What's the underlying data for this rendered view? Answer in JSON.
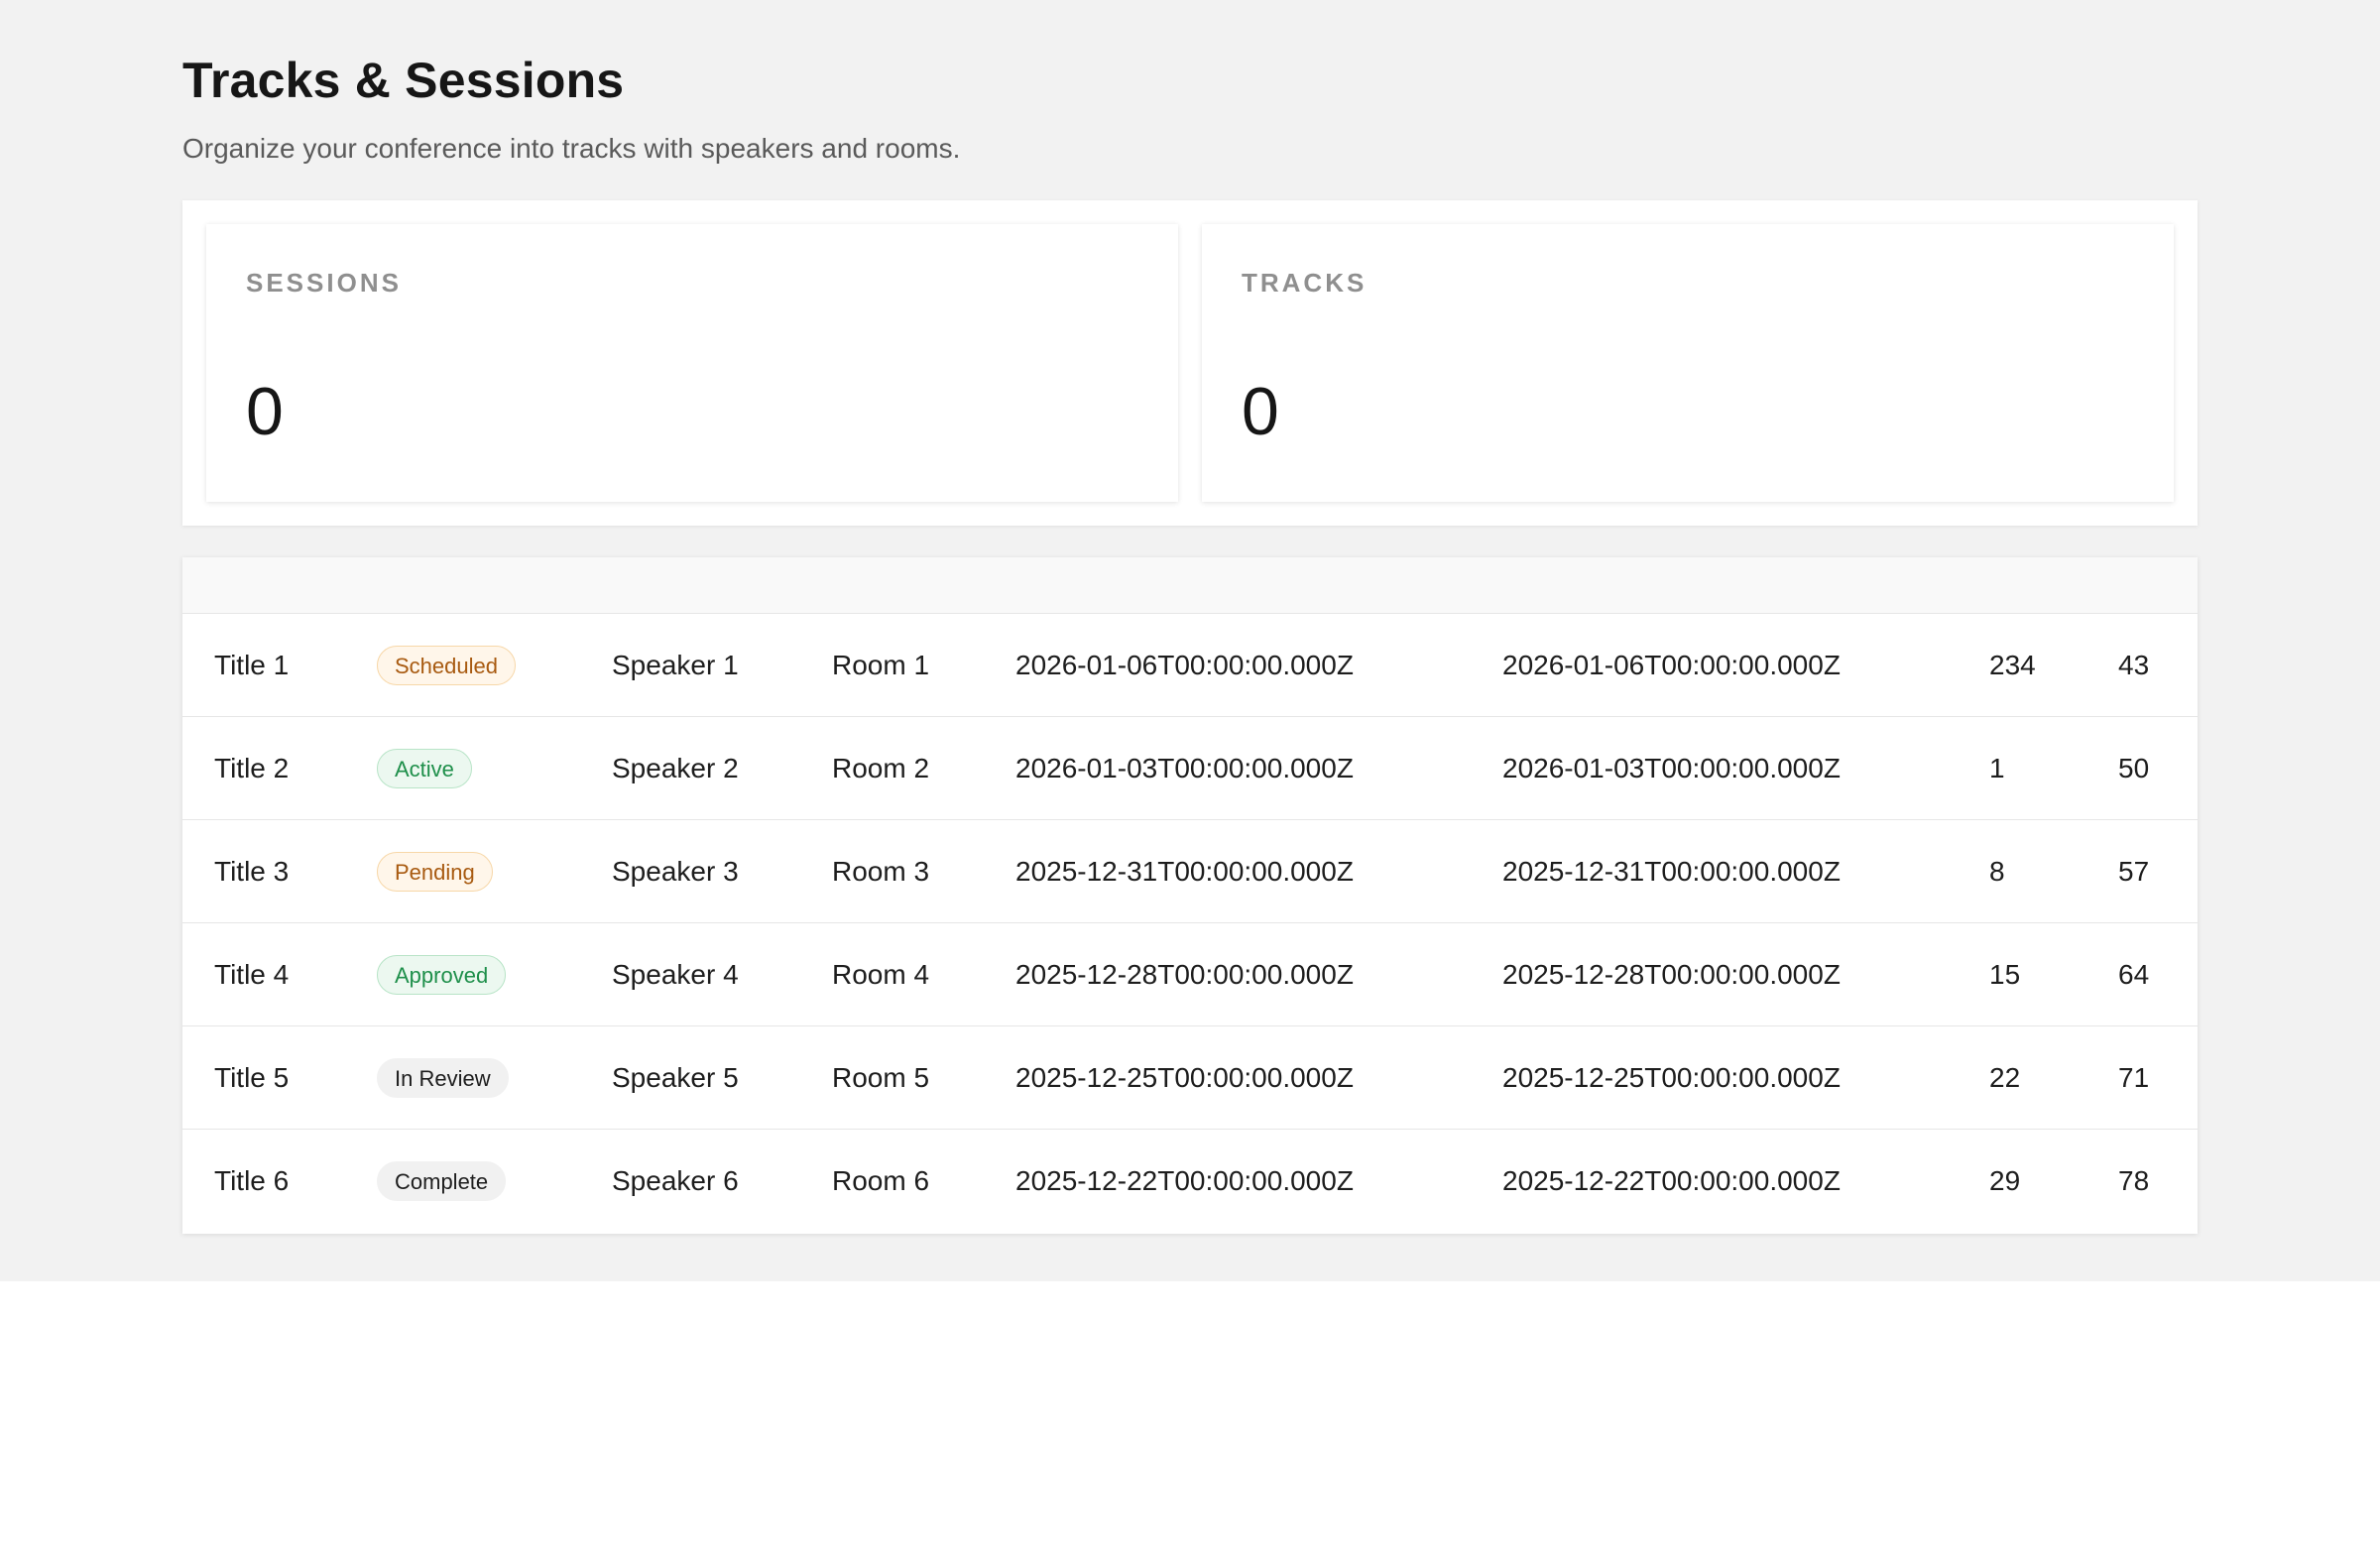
{
  "page": {
    "title": "Tracks & Sessions",
    "subtitle": "Organize your conference into tracks with speakers and rooms."
  },
  "stats": [
    {
      "label": "SESSIONS",
      "value": "0"
    },
    {
      "label": "TRACKS",
      "value": "0"
    }
  ],
  "colors": {
    "page_background": "#f2f2f2",
    "badge_orange_text": "#a85a10",
    "badge_green_text": "#1e8f4a",
    "badge_gray_text": "#1e1e1e"
  },
  "sessions": [
    {
      "title": "Title 1",
      "status": "Scheduled",
      "status_color": "orange",
      "speaker": "Speaker 1",
      "room": "Room 1",
      "start": "2026-01-06T00:00:00.000Z",
      "end": "2026-01-06T00:00:00.000Z",
      "n1": "234",
      "n2": "43"
    },
    {
      "title": "Title 2",
      "status": "Active",
      "status_color": "green",
      "speaker": "Speaker 2",
      "room": "Room 2",
      "start": "2026-01-03T00:00:00.000Z",
      "end": "2026-01-03T00:00:00.000Z",
      "n1": "1",
      "n2": "50"
    },
    {
      "title": "Title 3",
      "status": "Pending",
      "status_color": "orange",
      "speaker": "Speaker 3",
      "room": "Room 3",
      "start": "2025-12-31T00:00:00.000Z",
      "end": "2025-12-31T00:00:00.000Z",
      "n1": "8",
      "n2": "57"
    },
    {
      "title": "Title 4",
      "status": "Approved",
      "status_color": "green",
      "speaker": "Speaker 4",
      "room": "Room 4",
      "start": "2025-12-28T00:00:00.000Z",
      "end": "2025-12-28T00:00:00.000Z",
      "n1": "15",
      "n2": "64"
    },
    {
      "title": "Title 5",
      "status": "In Review",
      "status_color": "gray",
      "speaker": "Speaker 5",
      "room": "Room 5",
      "start": "2025-12-25T00:00:00.000Z",
      "end": "2025-12-25T00:00:00.000Z",
      "n1": "22",
      "n2": "71"
    },
    {
      "title": "Title 6",
      "status": "Complete",
      "status_color": "gray",
      "speaker": "Speaker 6",
      "room": "Room 6",
      "start": "2025-12-22T00:00:00.000Z",
      "end": "2025-12-22T00:00:00.000Z",
      "n1": "29",
      "n2": "78"
    }
  ]
}
